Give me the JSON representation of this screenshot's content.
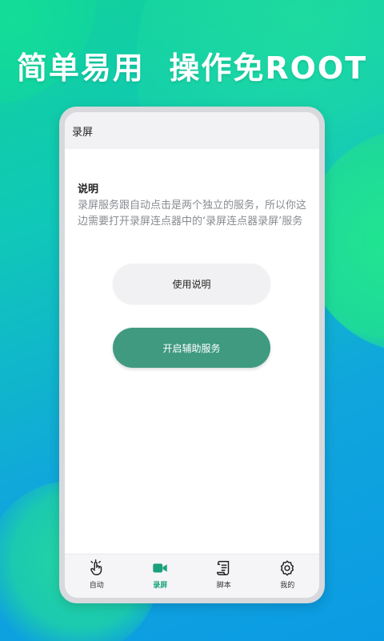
{
  "headline": "简单易用  操作免ROOT",
  "appbar": {
    "title": "录屏"
  },
  "info": {
    "title": "说明",
    "description": "录屏服务跟自动点击是两个独立的服务，所以你这边需要打开录屏连点器中的‘录屏连点器录屏’服务"
  },
  "buttons": {
    "guide_label": "使用说明",
    "service_label": "开启辅助服务"
  },
  "nav": {
    "items": [
      {
        "label": "自动",
        "icon": "hand-tap-icon"
      },
      {
        "label": "录屏",
        "icon": "video-camera-icon",
        "active": true
      },
      {
        "label": "脚本",
        "icon": "scroll-icon"
      },
      {
        "label": "我的",
        "icon": "gear-icon"
      }
    ]
  },
  "colors": {
    "accent": "#3f9a80",
    "active_nav": "#1aa07a",
    "background_start": "#12d19a",
    "background_end": "#0b9be3"
  }
}
